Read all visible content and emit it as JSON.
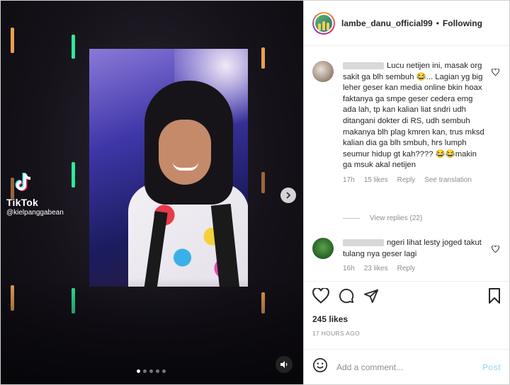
{
  "media": {
    "watermark_brand": "TikTok",
    "watermark_handle": "@kielpanggabean",
    "carousel_dot_count": 5,
    "carousel_active_index": 0
  },
  "header": {
    "username": "lambe_danu_official99",
    "separator": "•",
    "follow_label": "Following"
  },
  "comments": [
    {
      "text": "Lucu netijen ini, masak org sakit ga blh sembuh 😂... Lagian yg big leher geser kan media online bkin hoax faktanya ga smpe geser cedera emg ada lah, tp kan kalian liat sndri udh ditangani dokter di RS, udh sembuh makanya blh plag kmren kan, trus mksd kalian dia ga blh smbuh, hrs lumph seumur hidup gt kah???? 😂😂makin ga msuk akal netijen",
      "time": "17h",
      "likes": "15 likes",
      "reply": "Reply",
      "translate": "See translation",
      "view_replies": "View replies (22)"
    },
    {
      "text": "ngeri lihat lesty joged takut tulang nya geser lagi",
      "time": "16h",
      "likes": "23 likes",
      "reply": "Reply"
    }
  ],
  "footer": {
    "likes": "245 likes",
    "timestamp": "17 HOURS AGO",
    "comment_placeholder": "Add a comment...",
    "post_label": "Post"
  },
  "colors": {
    "post_disabled": "#b2dffc",
    "meta_text": "#8e8e8e",
    "accent_green": "#2ee89a"
  }
}
